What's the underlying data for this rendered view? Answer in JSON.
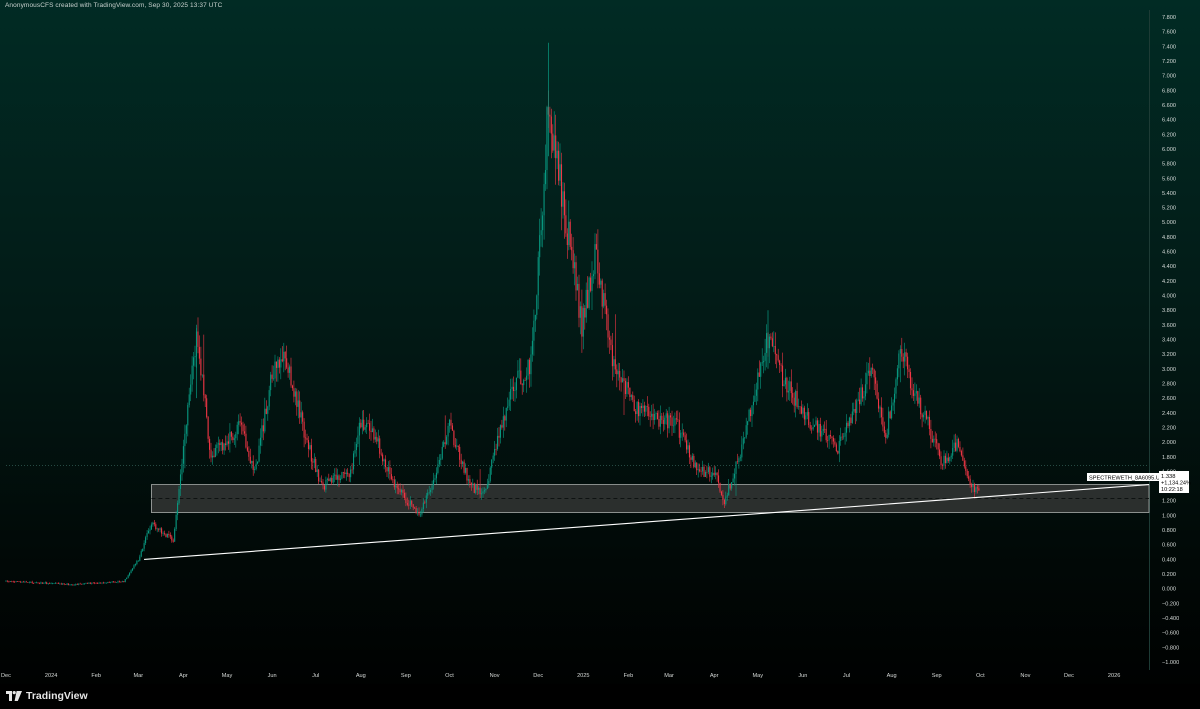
{
  "attribution": "AnonymousCFS created with TradingView.com, Sep 30, 2025 13:37 UTC",
  "brand": {
    "name": "TradingView",
    "icon": "tradingview-logo-icon"
  },
  "colors": {
    "up": "#089981",
    "down": "#f23645",
    "zone_fill": "#3b3d3c",
    "zone_border": "#a9adab",
    "trendline": "#ffffff",
    "axis_text": "#d6dbd9"
  },
  "chart_data": {
    "type": "candlestick",
    "symbol_label": "SPECTREWETH_8A6095.USD",
    "last_price": "1.338",
    "change_label": "+1,134.24%",
    "countdown": "10:22:18",
    "y_ticks": [
      "7.800",
      "7.600",
      "7.400",
      "7.200",
      "7.000",
      "6.800",
      "6.600",
      "6.400",
      "6.200",
      "6.000",
      "5.800",
      "5.600",
      "5.400",
      "5.200",
      "5.000",
      "4.800",
      "4.600",
      "4.400",
      "4.200",
      "4.000",
      "3.800",
      "3.600",
      "3.400",
      "3.200",
      "3.000",
      "2.800",
      "2.600",
      "2.400",
      "2.200",
      "2.000",
      "1.800",
      "1.600",
      "1.400",
      "1.200",
      "1.000",
      "0.800",
      "0.600",
      "0.400",
      "0.200",
      "0.000",
      "−0.200",
      "−0.400",
      "−0.600",
      "−0.800",
      "−1.000"
    ],
    "ylim": [
      -1.0,
      7.8
    ],
    "x_ticks": [
      "Dec",
      "2024",
      "Feb",
      "Mar",
      "Apr",
      "May",
      "Jun",
      "Jul",
      "Aug",
      "Sep",
      "Oct",
      "Nov",
      "Dec",
      "2025",
      "Feb",
      "Mar",
      "Apr",
      "May",
      "Jun",
      "Jul",
      "Aug",
      "Sep",
      "Oct",
      "Nov",
      "Dec",
      "2026"
    ],
    "xlim": [
      "2023-12-01",
      "2026-01-25"
    ],
    "last_date": "2025-09-30",
    "price_path": [
      [
        "2023-12-01",
        0.1
      ],
      [
        "2024-01-15",
        0.06
      ],
      [
        "2024-02-20",
        0.1
      ],
      [
        "2024-03-01",
        0.4
      ],
      [
        "2024-03-10",
        0.9
      ],
      [
        "2024-03-25",
        0.65
      ],
      [
        "2024-04-05",
        2.6
      ],
      [
        "2024-04-10",
        3.5
      ],
      [
        "2024-04-20",
        1.8
      ],
      [
        "2024-05-10",
        2.2
      ],
      [
        "2024-05-20",
        1.6
      ],
      [
        "2024-06-01",
        2.9
      ],
      [
        "2024-06-10",
        3.2
      ],
      [
        "2024-06-25",
        2.0
      ],
      [
        "2024-07-05",
        1.4
      ],
      [
        "2024-07-25",
        1.6
      ],
      [
        "2024-08-01",
        2.3
      ],
      [
        "2024-08-10",
        2.1
      ],
      [
        "2024-08-25",
        1.4
      ],
      [
        "2024-09-10",
        1.0
      ],
      [
        "2024-09-20",
        1.5
      ],
      [
        "2024-10-01",
        2.2
      ],
      [
        "2024-10-15",
        1.4
      ],
      [
        "2024-10-25",
        1.3
      ],
      [
        "2024-11-05",
        2.2
      ],
      [
        "2024-11-15",
        2.8
      ],
      [
        "2024-11-25",
        3.0
      ],
      [
        "2024-12-02",
        4.6
      ],
      [
        "2024-12-08",
        6.6
      ],
      [
        "2024-12-15",
        5.7
      ],
      [
        "2024-12-22",
        4.8
      ],
      [
        "2024-12-31",
        3.6
      ],
      [
        "2025-01-10",
        4.6
      ],
      [
        "2025-01-20",
        3.2
      ],
      [
        "2025-02-05",
        2.5
      ],
      [
        "2025-02-20",
        2.3
      ],
      [
        "2025-03-05",
        2.3
      ],
      [
        "2025-03-20",
        1.6
      ],
      [
        "2025-04-01",
        1.6
      ],
      [
        "2025-04-08",
        1.2
      ],
      [
        "2025-04-20",
        1.9
      ],
      [
        "2025-05-01",
        2.9
      ],
      [
        "2025-05-08",
        3.4
      ],
      [
        "2025-05-20",
        2.8
      ],
      [
        "2025-06-05",
        2.3
      ],
      [
        "2025-06-25",
        1.9
      ],
      [
        "2025-07-10",
        2.6
      ],
      [
        "2025-07-18",
        3.0
      ],
      [
        "2025-07-28",
        2.1
      ],
      [
        "2025-08-08",
        3.3
      ],
      [
        "2025-08-15",
        2.8
      ],
      [
        "2025-08-25",
        2.3
      ],
      [
        "2025-09-05",
        1.7
      ],
      [
        "2025-09-15",
        2.0
      ],
      [
        "2025-09-25",
        1.4
      ],
      [
        "2025-09-30",
        1.34
      ]
    ],
    "zone": {
      "from": "2024-03-10",
      "to": "2026-01-25",
      "top": 1.42,
      "bottom": 1.04,
      "mid": 1.23
    },
    "trendline": {
      "start": [
        "2024-03-05",
        0.4
      ],
      "end": [
        "2026-01-25",
        1.42
      ]
    }
  }
}
